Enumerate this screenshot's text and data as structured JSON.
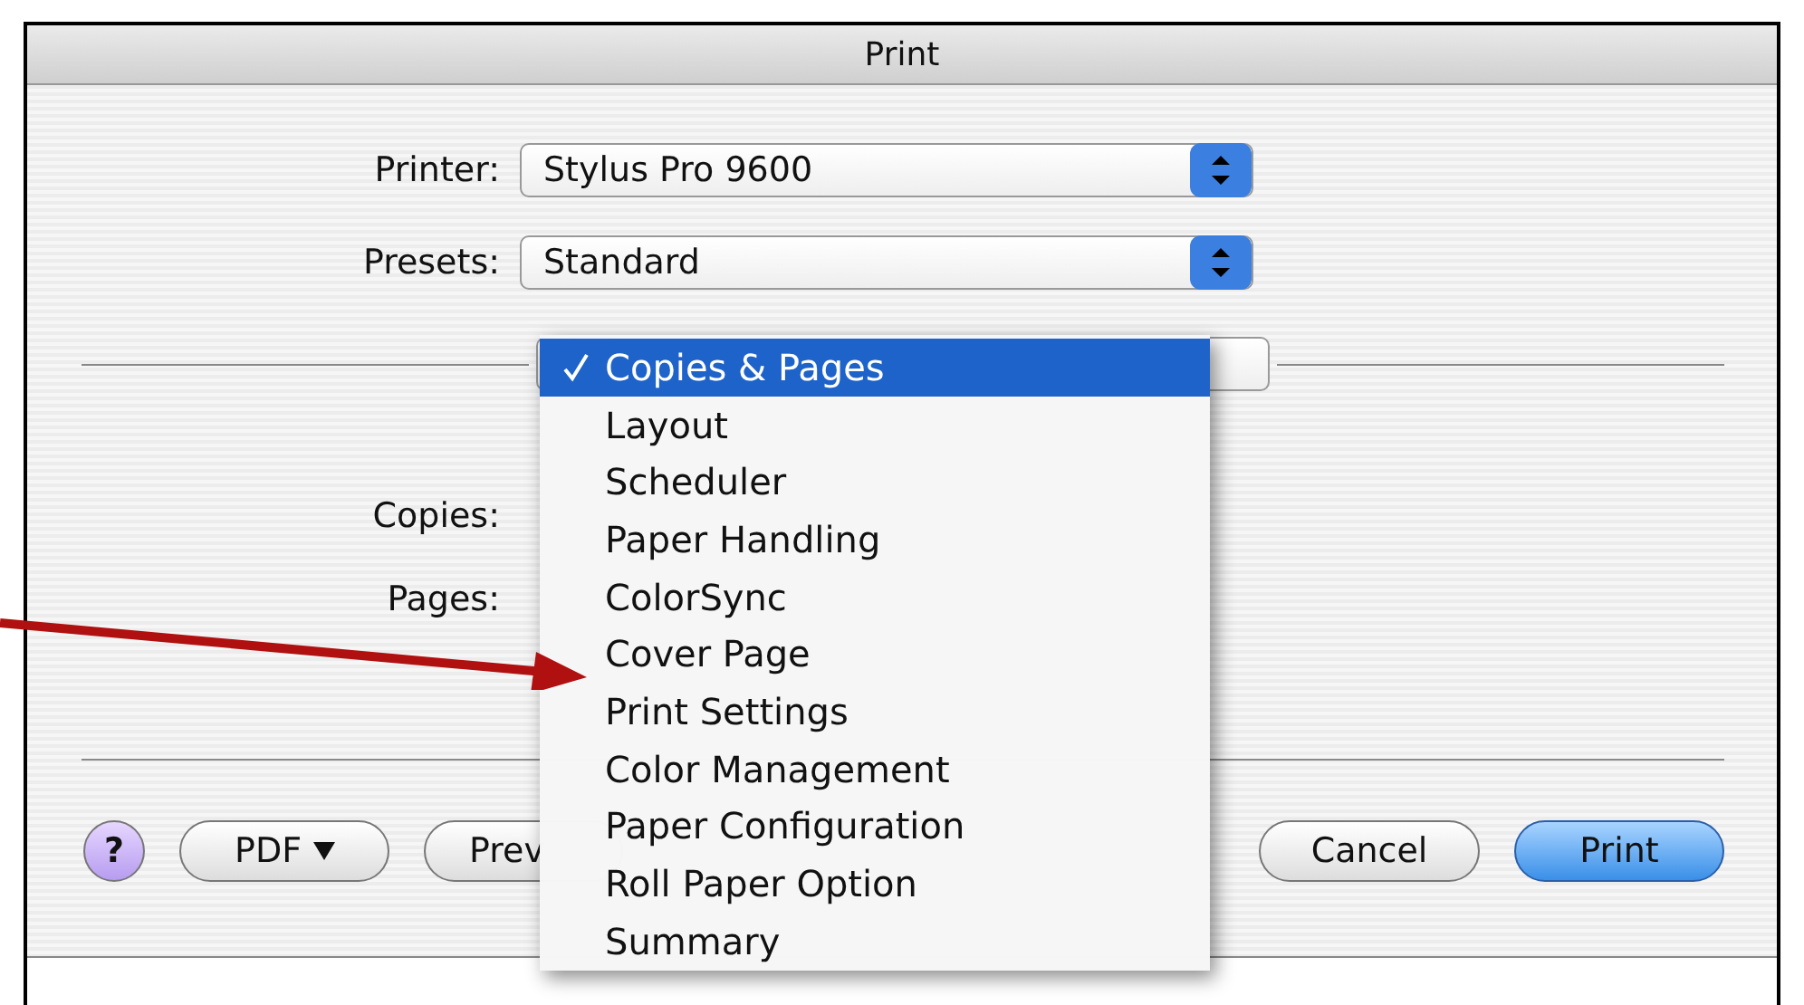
{
  "window": {
    "title": "Print"
  },
  "printer": {
    "label": "Printer:",
    "value": "Stylus Pro 9600"
  },
  "presets": {
    "label": "Presets:",
    "value": "Standard"
  },
  "copies": {
    "label": "Copies:"
  },
  "pages": {
    "label": "Pages:"
  },
  "buttons": [
    {
      "kind": "help",
      "label": "?"
    },
    {
      "kind": "menu",
      "label": "PDF"
    },
    {
      "kind": "plain",
      "label": "Prev"
    },
    {
      "kind": "plain",
      "label": "Cancel"
    },
    {
      "kind": "default",
      "label": "Print"
    }
  ],
  "panel_menu": {
    "items": [
      {
        "label": "Copies & Pages",
        "selected": true
      },
      {
        "label": "Layout",
        "selected": false
      },
      {
        "label": "Scheduler",
        "selected": false
      },
      {
        "label": "Paper Handling",
        "selected": false
      },
      {
        "label": "ColorSync",
        "selected": false
      },
      {
        "label": "Cover Page",
        "selected": false
      },
      {
        "label": "Print Settings",
        "selected": false
      },
      {
        "label": "Color Management",
        "selected": false
      },
      {
        "label": "Paper Configuration",
        "selected": false
      },
      {
        "label": "Roll Paper Option",
        "selected": false
      },
      {
        "label": "Summary",
        "selected": false
      }
    ]
  }
}
